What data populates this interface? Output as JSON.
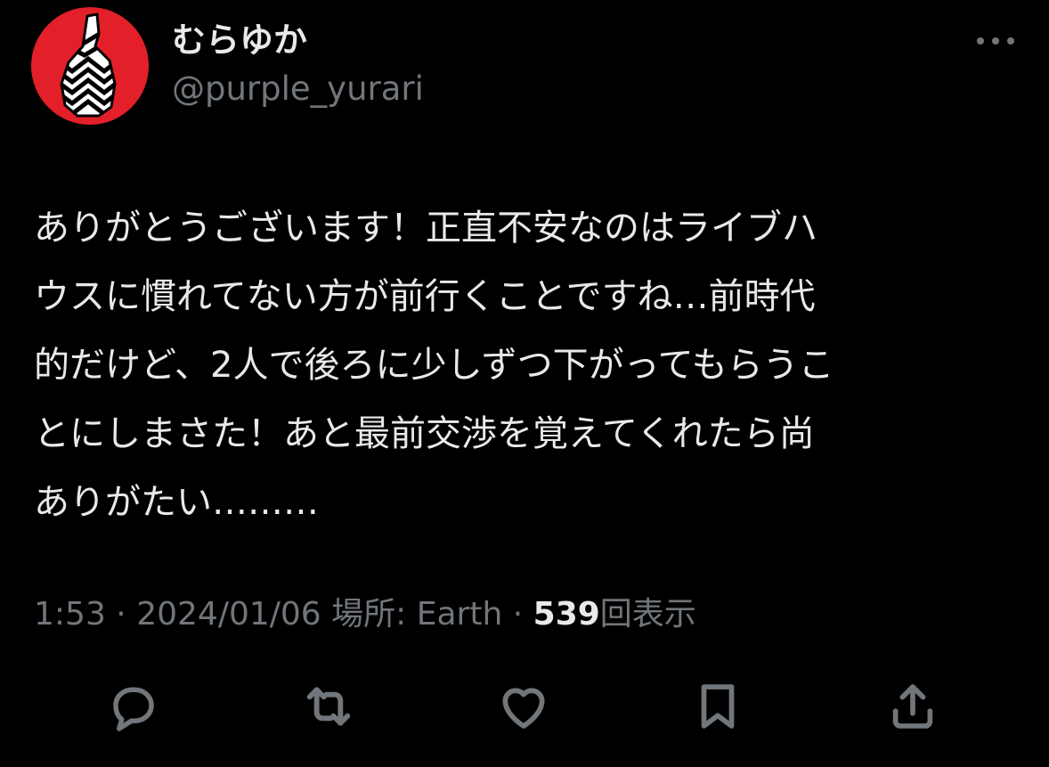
{
  "author": {
    "display_name": "むらゆか",
    "handle": "@purple_yurari",
    "avatar_icon": "bottle-avatar-icon",
    "avatar_bg": "#e3202a"
  },
  "header": {
    "more_icon": "more-dots-icon"
  },
  "tweet": {
    "lines": [
      "ありがとうございます！正直不安なのはライブハ",
      "ウスに慣れてない方が前行くことですね…前時代",
      "的だけど、2人で後ろに少しずつ下がってもらうこ",
      "とにしまさた！あと最前交渉を覚えてくれたら尚",
      "ありがたい………"
    ]
  },
  "meta": {
    "time": "1:53",
    "separator": "·",
    "date": "2024/01/06",
    "location": "場所: Earth",
    "views_count": "539",
    "views_label": "回表示"
  },
  "actions": [
    {
      "icon": "reply-icon"
    },
    {
      "icon": "retweet-icon"
    },
    {
      "icon": "like-icon"
    },
    {
      "icon": "bookmark-icon"
    },
    {
      "icon": "share-icon"
    }
  ],
  "colors": {
    "background": "#000000",
    "text_primary": "#e7e9ea",
    "text_secondary": "#71767b",
    "icon": "#71767b"
  }
}
